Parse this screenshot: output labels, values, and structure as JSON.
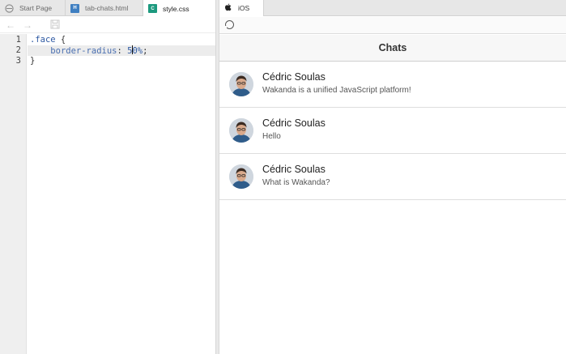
{
  "editor": {
    "tabs": [
      {
        "label": "Start Page",
        "icon": "start-page-icon"
      },
      {
        "label": "tab-chats.html",
        "icon": "html-file-icon"
      },
      {
        "label": "style.css",
        "icon": "css-file-icon"
      }
    ],
    "toolbar": {
      "back": "←",
      "forward": "→",
      "save": "save-icon"
    },
    "line_numbers": [
      "1",
      "2",
      "3"
    ],
    "code": {
      "line1_selector": ".face",
      "line1_brace": " {",
      "line2_indent": "    ",
      "line2_property": "border-radius",
      "line2_colon": ": ",
      "line2_value_a": "5",
      "line2_value_b": "0%",
      "line2_end": ";",
      "line3": "}"
    }
  },
  "preview": {
    "tab_label": "iOS",
    "nav_title": "Chats",
    "chats": [
      {
        "name": "Cédric Soulas",
        "message": "Wakanda is a unified JavaScript platform!"
      },
      {
        "name": "Cédric Soulas",
        "message": "Hello"
      },
      {
        "name": "Cédric Soulas",
        "message": "What is Wakanda?"
      }
    ]
  },
  "colors": {
    "css_keyword": "#2f5aa3",
    "css_file_badge": "#1d9a7f",
    "html_file_badge": "#3f7fc1"
  }
}
